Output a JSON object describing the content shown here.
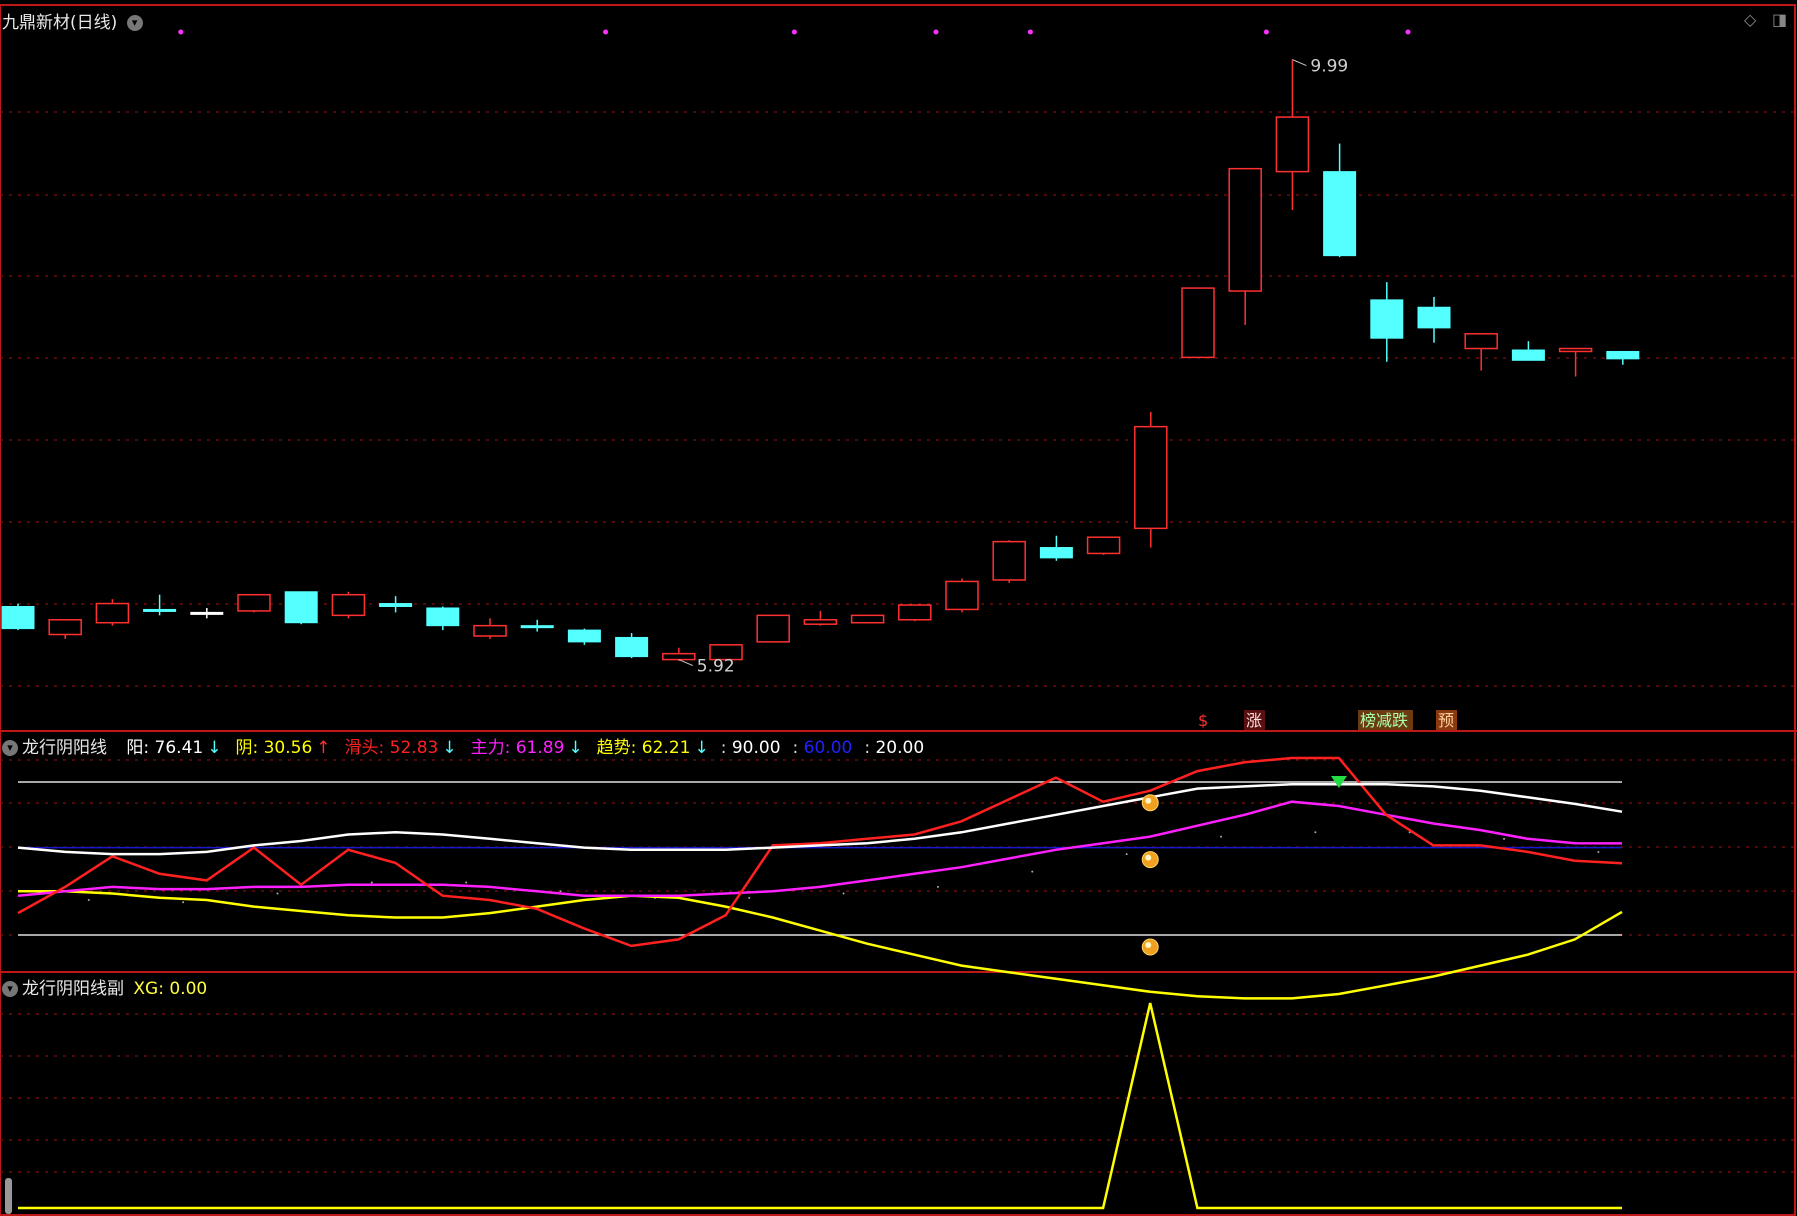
{
  "main_panel": {
    "title": "九鼎新材(日线)",
    "high_label": "9.99",
    "low_label": "5.92",
    "signal_tags": [
      "$",
      "涨",
      "榜减跌",
      "预"
    ]
  },
  "indicator_panel": {
    "title": "龙行阴阳线",
    "readouts": [
      {
        "label": "阳",
        "value": "76.41",
        "arrow": "↓",
        "color": "#ffffff"
      },
      {
        "label": "阴",
        "value": "30.56",
        "arrow": "↑",
        "color": "#ffff00"
      },
      {
        "label": "滑头",
        "value": "52.83",
        "arrow": "↓",
        "color": "#ff2020"
      },
      {
        "label": "主力",
        "value": "61.89",
        "arrow": "↓",
        "color": "#ff20ff"
      },
      {
        "label": "趋势",
        "value": "62.21",
        "arrow": "↓",
        "color": "#ffff00"
      }
    ],
    "levels": [
      {
        "value": "90.00",
        "color": "#ffffff"
      },
      {
        "value": "60.00",
        "color": "#2020ff"
      },
      {
        "value": "20.00",
        "color": "#ffffff"
      }
    ]
  },
  "sub_panel": {
    "title": "龙行阴阳线副",
    "readout_label": "XG",
    "readout_value": "0.00"
  },
  "colors": {
    "up": "#ff3030",
    "down": "#54ffff",
    "grid": "#a01010",
    "border": "#c01818"
  },
  "chart_data": [
    {
      "type": "candlestick",
      "title": "九鼎新材(日线)",
      "ylim": [
        5.7,
        10.15
      ],
      "candles": [
        {
          "o": 6.28,
          "h": 6.3,
          "l": 6.12,
          "c": 6.13,
          "dir": "down"
        },
        {
          "o": 6.09,
          "h": 6.18,
          "l": 6.06,
          "c": 6.19,
          "dir": "up"
        },
        {
          "o": 6.17,
          "h": 6.33,
          "l": 6.15,
          "c": 6.3,
          "dir": "up"
        },
        {
          "o": 6.26,
          "h": 6.36,
          "l": 6.22,
          "c": 6.26,
          "dir": "down"
        },
        {
          "o": 6.24,
          "h": 6.27,
          "l": 6.2,
          "c": 6.24,
          "dir": "flat"
        },
        {
          "o": 6.25,
          "h": 6.35,
          "l": 6.24,
          "c": 6.36,
          "dir": "up"
        },
        {
          "o": 6.38,
          "h": 6.38,
          "l": 6.16,
          "c": 6.17,
          "dir": "down"
        },
        {
          "o": 6.22,
          "h": 6.38,
          "l": 6.2,
          "c": 6.36,
          "dir": "up"
        },
        {
          "o": 6.3,
          "h": 6.35,
          "l": 6.24,
          "c": 6.28,
          "dir": "down"
        },
        {
          "o": 6.27,
          "h": 6.28,
          "l": 6.12,
          "c": 6.15,
          "dir": "down"
        },
        {
          "o": 6.08,
          "h": 6.2,
          "l": 6.06,
          "c": 6.15,
          "dir": "up"
        },
        {
          "o": 6.15,
          "h": 6.19,
          "l": 6.11,
          "c": 6.15,
          "dir": "down"
        },
        {
          "o": 6.12,
          "h": 6.13,
          "l": 6.02,
          "c": 6.04,
          "dir": "down"
        },
        {
          "o": 6.07,
          "h": 6.1,
          "l": 5.93,
          "c": 5.94,
          "dir": "down"
        },
        {
          "o": 5.92,
          "h": 6.0,
          "l": 5.91,
          "c": 5.96,
          "dir": "up"
        },
        {
          "o": 5.92,
          "h": 6.01,
          "l": 5.92,
          "c": 6.02,
          "dir": "up"
        },
        {
          "o": 6.04,
          "h": 6.22,
          "l": 6.04,
          "c": 6.22,
          "dir": "up"
        },
        {
          "o": 6.16,
          "h": 6.25,
          "l": 6.15,
          "c": 6.19,
          "dir": "up"
        },
        {
          "o": 6.17,
          "h": 6.22,
          "l": 6.17,
          "c": 6.22,
          "dir": "up"
        },
        {
          "o": 6.19,
          "h": 6.29,
          "l": 6.18,
          "c": 6.29,
          "dir": "up"
        },
        {
          "o": 6.26,
          "h": 6.47,
          "l": 6.24,
          "c": 6.45,
          "dir": "up"
        },
        {
          "o": 6.46,
          "h": 6.73,
          "l": 6.44,
          "c": 6.72,
          "dir": "up"
        },
        {
          "o": 6.68,
          "h": 6.76,
          "l": 6.59,
          "c": 6.61,
          "dir": "down"
        },
        {
          "o": 6.64,
          "h": 6.75,
          "l": 6.63,
          "c": 6.75,
          "dir": "up"
        },
        {
          "o": 6.81,
          "h": 7.6,
          "l": 6.68,
          "c": 7.5,
          "dir": "up"
        },
        {
          "o": 7.97,
          "h": 8.42,
          "l": 7.97,
          "c": 8.44,
          "dir": "up"
        },
        {
          "o": 8.42,
          "h": 9.25,
          "l": 8.19,
          "c": 9.25,
          "dir": "up"
        },
        {
          "o": 9.23,
          "h": 9.99,
          "l": 8.97,
          "c": 9.6,
          "dir": "up"
        },
        {
          "o": 9.23,
          "h": 9.42,
          "l": 8.65,
          "c": 8.66,
          "dir": "down"
        },
        {
          "o": 8.36,
          "h": 8.48,
          "l": 7.94,
          "c": 8.1,
          "dir": "down"
        },
        {
          "o": 8.31,
          "h": 8.38,
          "l": 8.07,
          "c": 8.17,
          "dir": "down"
        },
        {
          "o": 8.03,
          "h": 8.13,
          "l": 7.88,
          "c": 8.13,
          "dir": "up"
        },
        {
          "o": 8.02,
          "h": 8.08,
          "l": 7.96,
          "c": 7.95,
          "dir": "down"
        },
        {
          "o": 8.01,
          "h": 8.03,
          "l": 7.84,
          "c": 8.03,
          "dir": "up"
        },
        {
          "o": 8.01,
          "h": 8.01,
          "l": 7.92,
          "c": 7.96,
          "dir": "down"
        }
      ]
    },
    {
      "type": "line",
      "title": "龙行阴阳线",
      "ylim": [
        -10,
        105
      ],
      "x": [
        0,
        1,
        2,
        3,
        4,
        5,
        6,
        7,
        8,
        9,
        10,
        11,
        12,
        13,
        14,
        15,
        16,
        17,
        18,
        19,
        20,
        21,
        22,
        23,
        24,
        25,
        26,
        27,
        28,
        29,
        30,
        31,
        32,
        33,
        34
      ],
      "reference_lines": [
        90,
        60,
        20
      ],
      "series": [
        {
          "name": "阳",
          "color": "#ffffff",
          "values": [
            60,
            58,
            57,
            57,
            58,
            61,
            63,
            66,
            67,
            66,
            64,
            62,
            60,
            59,
            59,
            59,
            60,
            61,
            62,
            64,
            67,
            71,
            75,
            79,
            83,
            87,
            88,
            89,
            89,
            89,
            88,
            86,
            83,
            80,
            76.41
          ]
        },
        {
          "name": "阴",
          "color": "#ffff00",
          "values": [
            40,
            40,
            39,
            37,
            36,
            33,
            31,
            29,
            28,
            28,
            30,
            33,
            36,
            38,
            37,
            33,
            28,
            22,
            16,
            11,
            6,
            3,
            0,
            -3,
            -6,
            -8,
            -9,
            -9,
            -7,
            -3,
            1,
            6,
            11,
            18,
            30.56
          ]
        },
        {
          "name": "滑头",
          "color": "#ff2020",
          "values": [
            30,
            42,
            56,
            48,
            45,
            60,
            43,
            59,
            53,
            38,
            36,
            32,
            23,
            15,
            18,
            29,
            61,
            62,
            64,
            66,
            72,
            82,
            92,
            81,
            86,
            95,
            99,
            101,
            101,
            75,
            61,
            61,
            58,
            54,
            52.83
          ]
        },
        {
          "name": "主力",
          "color": "#ff20ff",
          "values": [
            38,
            40,
            42,
            41,
            41,
            42,
            42,
            43,
            43,
            43,
            42,
            40,
            38,
            38,
            38,
            39,
            40,
            42,
            45,
            48,
            51,
            55,
            59,
            62,
            65,
            70,
            75,
            81,
            79,
            75,
            71,
            68,
            64,
            62,
            61.89
          ]
        },
        {
          "name": "趋势",
          "color": "#ffff00",
          "values": [
            40,
            40,
            39,
            37,
            36,
            33,
            31,
            29,
            28,
            28,
            30,
            33,
            36,
            38,
            37,
            33,
            28,
            22,
            16,
            11,
            6,
            3,
            0,
            -3,
            -6,
            -8,
            -9,
            -9,
            -7,
            -3,
            1,
            6,
            11,
            18,
            30.56
          ]
        }
      ]
    },
    {
      "type": "line",
      "title": "龙行阴阳线副",
      "ylim": [
        0,
        1.05
      ],
      "x": [
        0,
        1,
        2,
        3,
        4,
        5,
        6,
        7,
        8,
        9,
        10,
        11,
        12,
        13,
        14,
        15,
        16,
        17,
        18,
        19,
        20,
        21,
        22,
        23,
        24,
        25,
        26,
        27,
        28,
        29,
        30,
        31,
        32,
        33,
        34
      ],
      "series": [
        {
          "name": "XG",
          "color": "#ffff00",
          "values": [
            0,
            0,
            0,
            0,
            0,
            0,
            0,
            0,
            0,
            0,
            0,
            0,
            0,
            0,
            0,
            0,
            0,
            0,
            0,
            0,
            0,
            0,
            0,
            0,
            1,
            0,
            0,
            0,
            0,
            0,
            0,
            0,
            0,
            0,
            0
          ]
        }
      ]
    }
  ]
}
